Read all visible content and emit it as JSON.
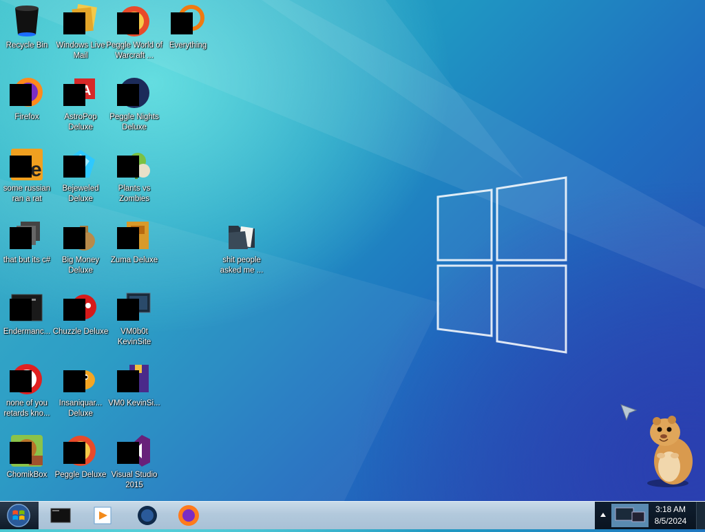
{
  "desktop": {
    "icons": [
      {
        "label": "Recycle Bin"
      },
      {
        "label": "Windows Live Mail"
      },
      {
        "label": "Peggle World of Warcraft ..."
      },
      {
        "label": "Everything"
      },
      {
        "label": "Firefox"
      },
      {
        "label": "AstroPop Deluxe"
      },
      {
        "label": "Peggle Nights Deluxe"
      },
      {
        "label": "some russian ran a rat"
      },
      {
        "label": "Bejeweled Deluxe"
      },
      {
        "label": "Plants vs Zombies"
      },
      {
        "label": "that but its c#"
      },
      {
        "label": "Big Money Deluxe"
      },
      {
        "label": "Zuma Deluxe"
      },
      {
        "label": "shit people asked me ..."
      },
      {
        "label": "Endermanc..."
      },
      {
        "label": "Chuzzle Deluxe"
      },
      {
        "label": "VM0b0t KevinSite"
      },
      {
        "label": "none of you retards kno..."
      },
      {
        "label": "Insaniquar... Deluxe"
      },
      {
        "label": "VM0 KevinSi..."
      },
      {
        "label": "ChomikBox"
      },
      {
        "label": "Peggle Deluxe"
      },
      {
        "label": "Visual Studio 2015"
      }
    ]
  },
  "taskbar": {
    "start_icon": "windows-start-orb-icon",
    "pinned": [
      {
        "icon": "terminal-icon"
      },
      {
        "icon": "media-player-icon"
      },
      {
        "icon": "globe-icon"
      },
      {
        "icon": "firefox-icon"
      }
    ],
    "tray": {
      "show_hidden_icon": "triangle-up-icon",
      "network_icon": "network-icon"
    },
    "clock": {
      "time": "3:18 AM",
      "date": "8/5/2024"
    }
  },
  "colors": {
    "desktop_light": "#64dde0",
    "desktop_dark": "#2a3fae",
    "taskbar": "#b2c9dc",
    "tray": "#0f1e2f"
  }
}
